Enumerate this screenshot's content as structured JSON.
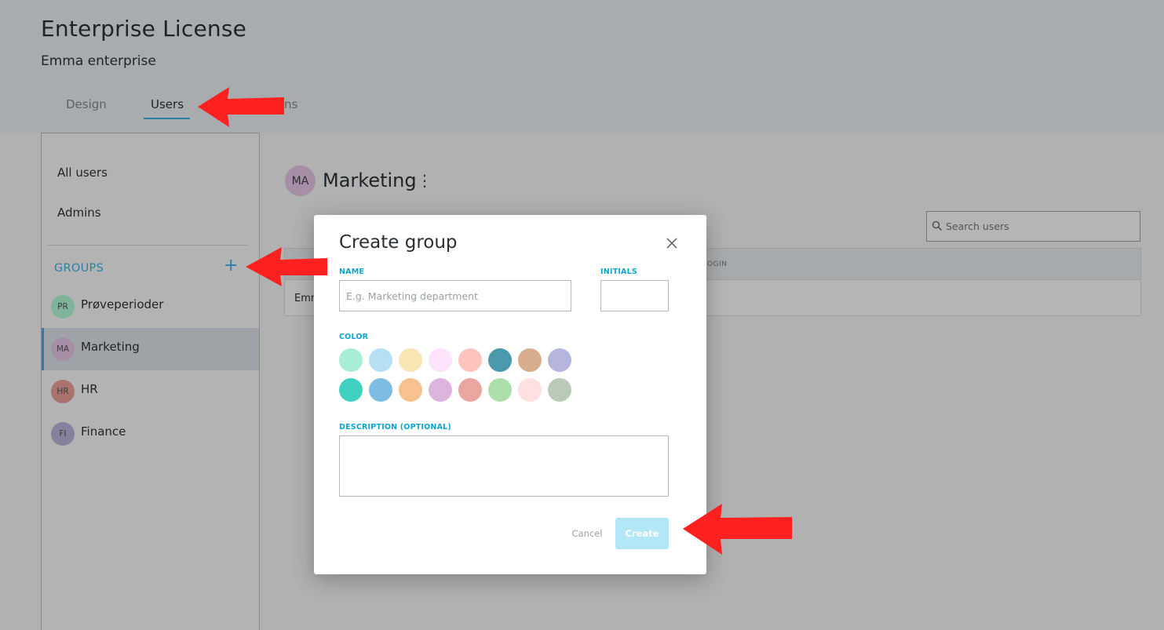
{
  "header": {
    "title": "Enterprise License",
    "subtitle": "Emma enterprise",
    "tabs": [
      {
        "label": "Design",
        "active": false
      },
      {
        "label": "Users",
        "active": true
      },
      {
        "label": "ns",
        "active": false
      }
    ]
  },
  "sidebar": {
    "links": [
      "All users",
      "Admins"
    ],
    "groups_label": "GROUPS",
    "add_symbol": "+",
    "groups": [
      {
        "initials": "PR",
        "name": "Prøveperioder",
        "color": "#7fb39a",
        "active": false
      },
      {
        "initials": "MA",
        "name": "Marketing",
        "color": "#a68fa6",
        "active": true
      },
      {
        "initials": "HR",
        "name": "HR",
        "color": "#a9726c",
        "active": false
      },
      {
        "initials": "FI",
        "name": "Finance",
        "color": "#86829e",
        "active": false
      }
    ]
  },
  "main": {
    "group_initials": "MA",
    "group_title": "Marketing",
    "menu_symbol": "⋮",
    "search_placeholder": "Search users",
    "table": {
      "partial_header": "OGIN",
      "partial_cell": "Emm"
    }
  },
  "modal": {
    "title": "Create group",
    "name_label": "NAME",
    "name_placeholder": "E.g. Marketing department",
    "initials_label": "INITIALS",
    "color_label": "COLOR",
    "colors": [
      "#a8eed4",
      "#b5dff3",
      "#f7e6b3",
      "#fde2fb",
      "#fdc4be",
      "#4a98ab",
      "#d7ad8c",
      "#b5b5dd",
      "#41d1c0",
      "#7dbde1",
      "#f6c08f",
      "#dcb4de",
      "#eba5a1",
      "#addfaa",
      "#fde0df",
      "#b9cbb7"
    ],
    "description_label": "DESCRIPTION (OPTIONAL)",
    "cancel_label": "Cancel",
    "create_label": "Create"
  },
  "annotation_color": "#ff2020"
}
